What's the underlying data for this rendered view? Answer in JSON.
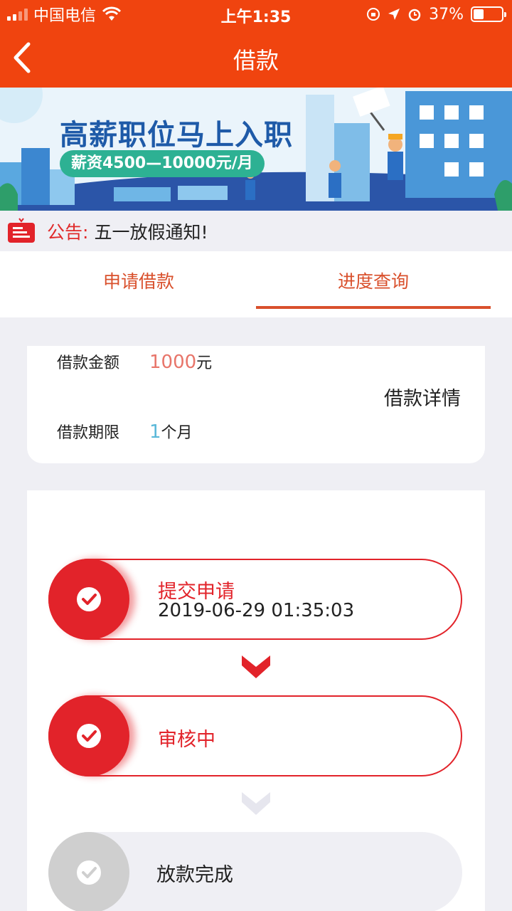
{
  "status_bar": {
    "carrier": "中国电信",
    "time": "上午1:35",
    "battery": "37%"
  },
  "nav": {
    "title": "借款"
  },
  "banner": {
    "headline": "高薪职位马上入职",
    "salary": "薪资4500—10000元/月"
  },
  "notice": {
    "label": "公告:",
    "text": "五一放假通知!"
  },
  "tabs": [
    {
      "label": "申请借款",
      "active": false
    },
    {
      "label": "进度查询",
      "active": true
    }
  ],
  "loan": {
    "amount_label": "借款金额",
    "amount_value": "1000",
    "amount_unit": "元",
    "term_label": "借款期限",
    "term_value": "1",
    "term_unit": "个月",
    "detail_link": "借款详情"
  },
  "steps": [
    {
      "title": "提交申请",
      "time": "2019-06-29 01:35:03",
      "state": "done"
    },
    {
      "title": "审核中",
      "state": "done"
    },
    {
      "title": "放款完成",
      "state": "pending"
    }
  ],
  "colors": {
    "brand": "#f0440f",
    "accent": "#e2232a",
    "tab": "#d9502c",
    "amount": "#e8756a",
    "term": "#5ab8d8"
  }
}
